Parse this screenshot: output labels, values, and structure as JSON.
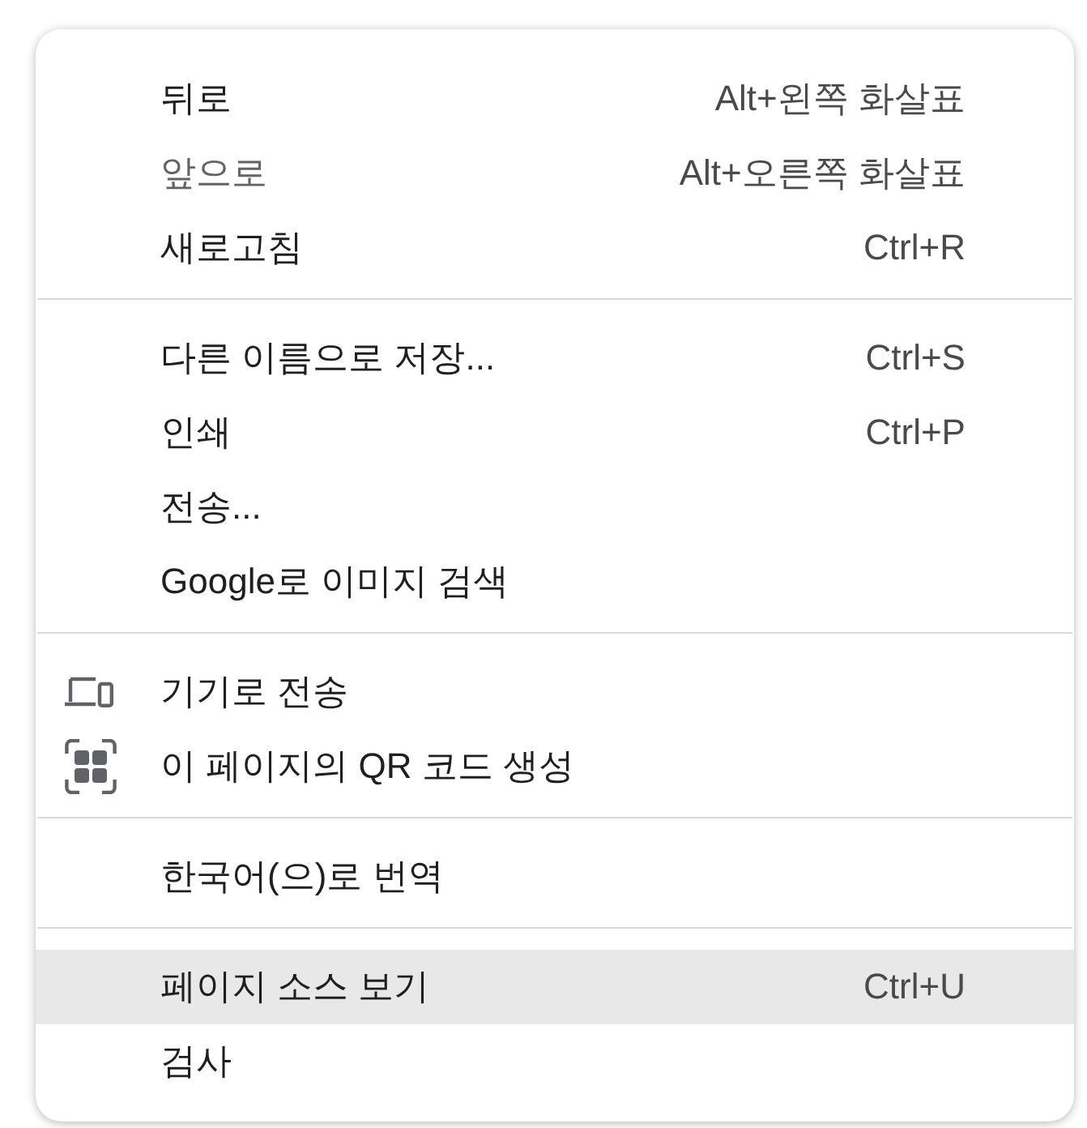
{
  "menu": {
    "groups": [
      {
        "items": [
          {
            "kind": "plain",
            "label": "뒤로",
            "shortcut": "Alt+왼쪽 화살표",
            "disabled": false,
            "highlighted": false
          },
          {
            "kind": "plain",
            "label": "앞으로",
            "shortcut": "Alt+오른쪽 화살표",
            "disabled": true,
            "highlighted": false
          },
          {
            "kind": "plain",
            "label": "새로고침",
            "shortcut": "Ctrl+R",
            "disabled": false,
            "highlighted": false
          }
        ]
      },
      {
        "items": [
          {
            "kind": "plain",
            "label": "다른 이름으로 저장...",
            "shortcut": "Ctrl+S",
            "disabled": false,
            "highlighted": false
          },
          {
            "kind": "plain",
            "label": "인쇄",
            "shortcut": "Ctrl+P",
            "disabled": false,
            "highlighted": false
          },
          {
            "kind": "plain",
            "label": "전송...",
            "disabled": false,
            "highlighted": false
          },
          {
            "kind": "plain",
            "label": "Google로 이미지 검색",
            "disabled": false,
            "highlighted": false
          }
        ]
      },
      {
        "items": [
          {
            "kind": "send-to-device",
            "label": "기기로 전송",
            "disabled": false,
            "highlighted": false
          },
          {
            "kind": "qr-code",
            "label": "이 페이지의 QR 코드 생성",
            "disabled": false,
            "highlighted": false
          }
        ]
      },
      {
        "items": [
          {
            "kind": "plain",
            "label": "한국어(으)로 번역",
            "disabled": false,
            "highlighted": false
          }
        ]
      },
      {
        "items": [
          {
            "kind": "plain",
            "label": "페이지 소스 보기",
            "shortcut": "Ctrl+U",
            "disabled": false,
            "highlighted": true
          },
          {
            "kind": "plain",
            "label": "검사",
            "disabled": false,
            "highlighted": false
          }
        ]
      }
    ]
  }
}
